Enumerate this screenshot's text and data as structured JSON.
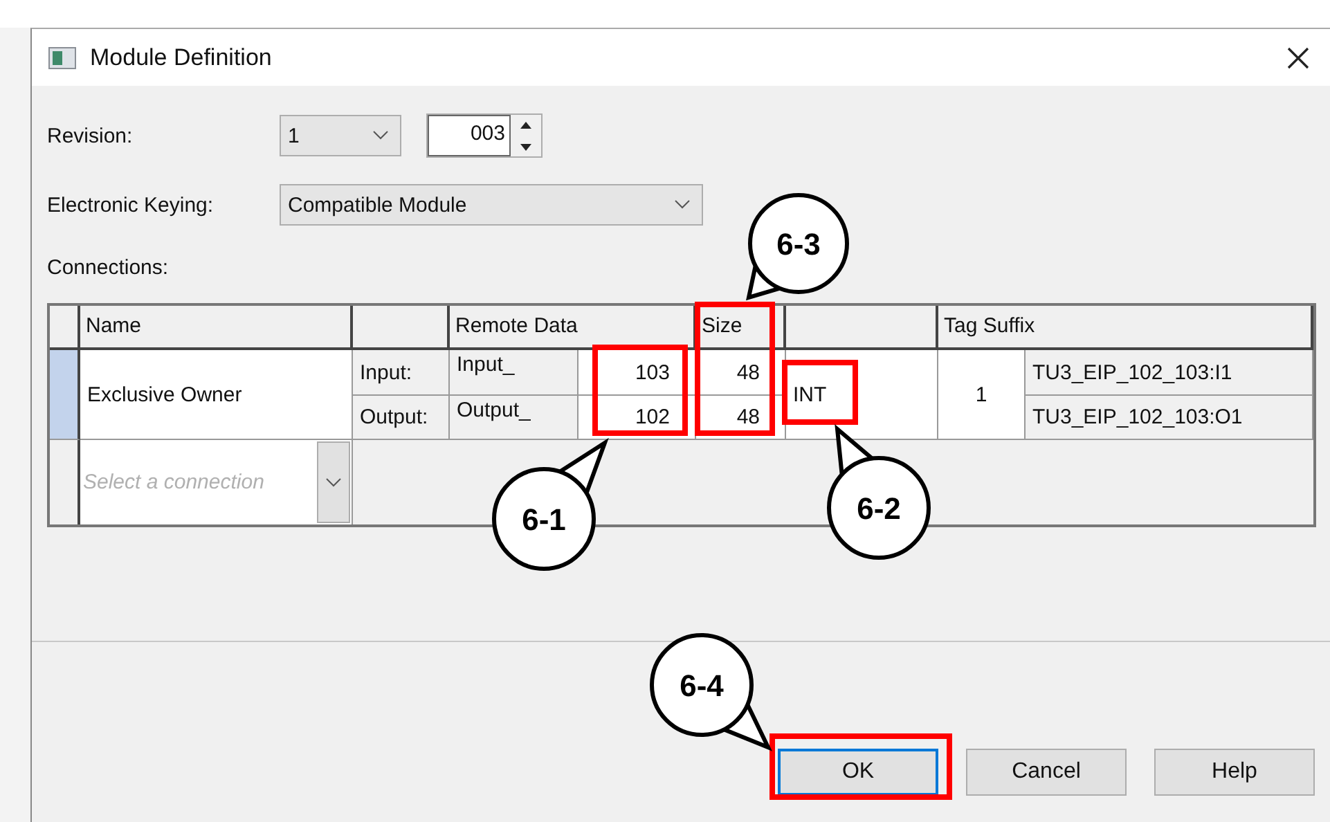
{
  "window": {
    "title": "Module Definition"
  },
  "revision": {
    "label": "Revision:",
    "major": "1",
    "minor": "003"
  },
  "electronic_keying": {
    "label": "Electronic Keying:",
    "value": "Compatible Module"
  },
  "connections": {
    "label": "Connections:",
    "columns": [
      {
        "label": "Name"
      },
      {
        "label": "Remote Data"
      },
      {
        "label": "Size"
      },
      {
        "label": "Tag Suffix"
      }
    ],
    "rows": [
      {
        "name": "Exclusive Owner",
        "selected": true,
        "data_type": "INT",
        "suffix_number": "1",
        "lines": [
          {
            "label": "Input:",
            "assembly": "Input_",
            "instance": "103",
            "size": "48",
            "tag": "TU3_EIP_102_103:I1"
          },
          {
            "label": "Output:",
            "assembly": "Output_",
            "instance": "102",
            "size": "48",
            "tag": "TU3_EIP_102_103:O1"
          }
        ]
      }
    ],
    "new_row": {
      "placeholder": "Select a connection"
    }
  },
  "buttons": [
    {
      "label": "OK",
      "default": true
    },
    {
      "label": "Cancel",
      "default": false
    },
    {
      "label": "Help",
      "default": false
    }
  ],
  "annotations": [
    {
      "label": "6-1"
    },
    {
      "label": "6-2"
    },
    {
      "label": "6-3"
    },
    {
      "label": "6-4"
    }
  ]
}
